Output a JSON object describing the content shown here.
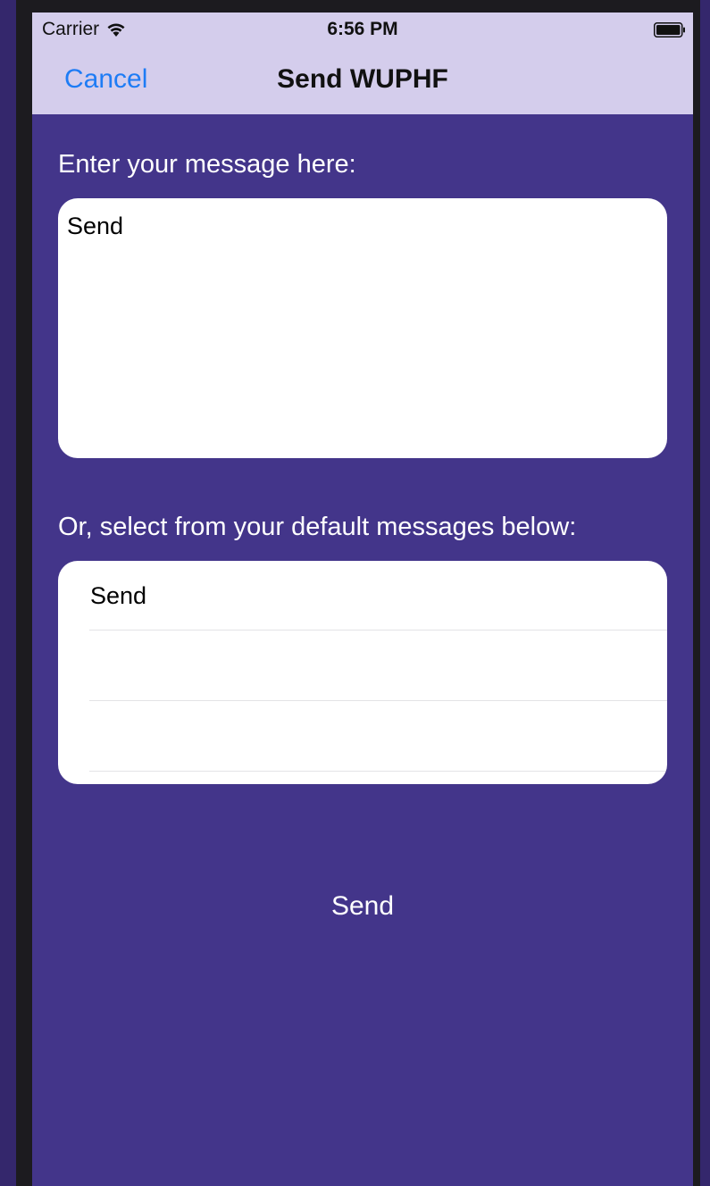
{
  "status_bar": {
    "carrier": "Carrier",
    "time": "6:56 PM"
  },
  "nav": {
    "cancel_label": "Cancel",
    "title": "Send WUPHF"
  },
  "compose": {
    "prompt": "Enter your message here:",
    "message_value": "Send"
  },
  "defaults": {
    "prompt": "Or, select from your default messages below:",
    "items": [
      "Send",
      "",
      ""
    ]
  },
  "send_label": "Send",
  "colors": {
    "background": "#43358a",
    "nav_background": "#d4cdec",
    "accent": "#1e7cf5"
  }
}
